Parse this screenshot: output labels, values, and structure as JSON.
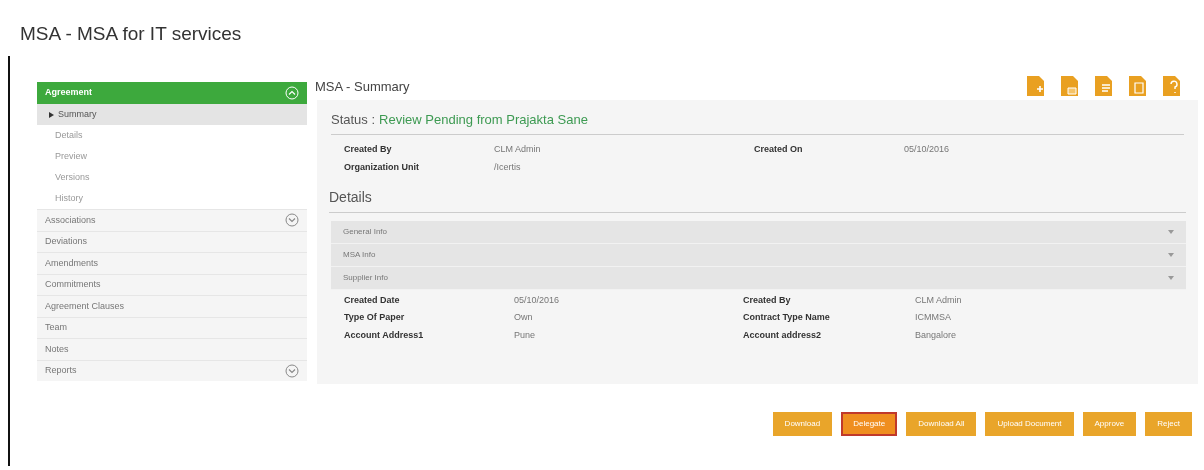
{
  "page_title": "MSA - MSA for IT services",
  "section_title": "MSA - Summary",
  "sidebar": {
    "header": {
      "label": "Agreement",
      "expanded": true
    },
    "sub_items": [
      {
        "label": "Summary",
        "selected": true
      },
      {
        "label": "Details",
        "selected": false
      },
      {
        "label": "Preview",
        "selected": false
      },
      {
        "label": "Versions",
        "selected": false
      },
      {
        "label": "History",
        "selected": false
      }
    ],
    "items": [
      {
        "label": "Associations",
        "expandable": true
      },
      {
        "label": "Deviations",
        "expandable": false
      },
      {
        "label": "Amendments",
        "expandable": false
      },
      {
        "label": "Commitments",
        "expandable": false
      },
      {
        "label": "Agreement Clauses",
        "expandable": false
      },
      {
        "label": "Team",
        "expandable": false
      },
      {
        "label": "Notes",
        "expandable": false
      },
      {
        "label": "Reports",
        "expandable": true
      }
    ]
  },
  "status": {
    "label": "Status :",
    "value": "Review Pending from Prajakta Sane"
  },
  "summary_fields": [
    {
      "label": "Created By",
      "value": "CLM Admin"
    },
    {
      "label": "Created On",
      "value": "05/10/2016"
    },
    {
      "label": "Organization Unit",
      "value": "/Icertis"
    }
  ],
  "details_title": "Details",
  "details_sections": [
    {
      "label": "General Info",
      "expanded": false
    },
    {
      "label": "MSA Info",
      "expanded": false
    },
    {
      "label": "Supplier Info",
      "expanded": false
    }
  ],
  "details_fields": [
    {
      "label": "Created Date",
      "value": "05/10/2016"
    },
    {
      "label": "Created By",
      "value": "CLM Admin"
    },
    {
      "label": "Type Of Paper",
      "value": "Own"
    },
    {
      "label": "Contract Type Name",
      "value": "ICMMSA"
    },
    {
      "label": "Account Address1",
      "value": "Pune"
    },
    {
      "label": "Account address2",
      "value": "Bangalore"
    }
  ],
  "actions": [
    {
      "label": "Download",
      "selected": false
    },
    {
      "label": "Delegate",
      "selected": true
    },
    {
      "label": "Download All",
      "selected": false
    },
    {
      "label": "Upload Document",
      "selected": false
    },
    {
      "label": "Approve",
      "selected": false
    },
    {
      "label": "Reject",
      "selected": false
    }
  ]
}
